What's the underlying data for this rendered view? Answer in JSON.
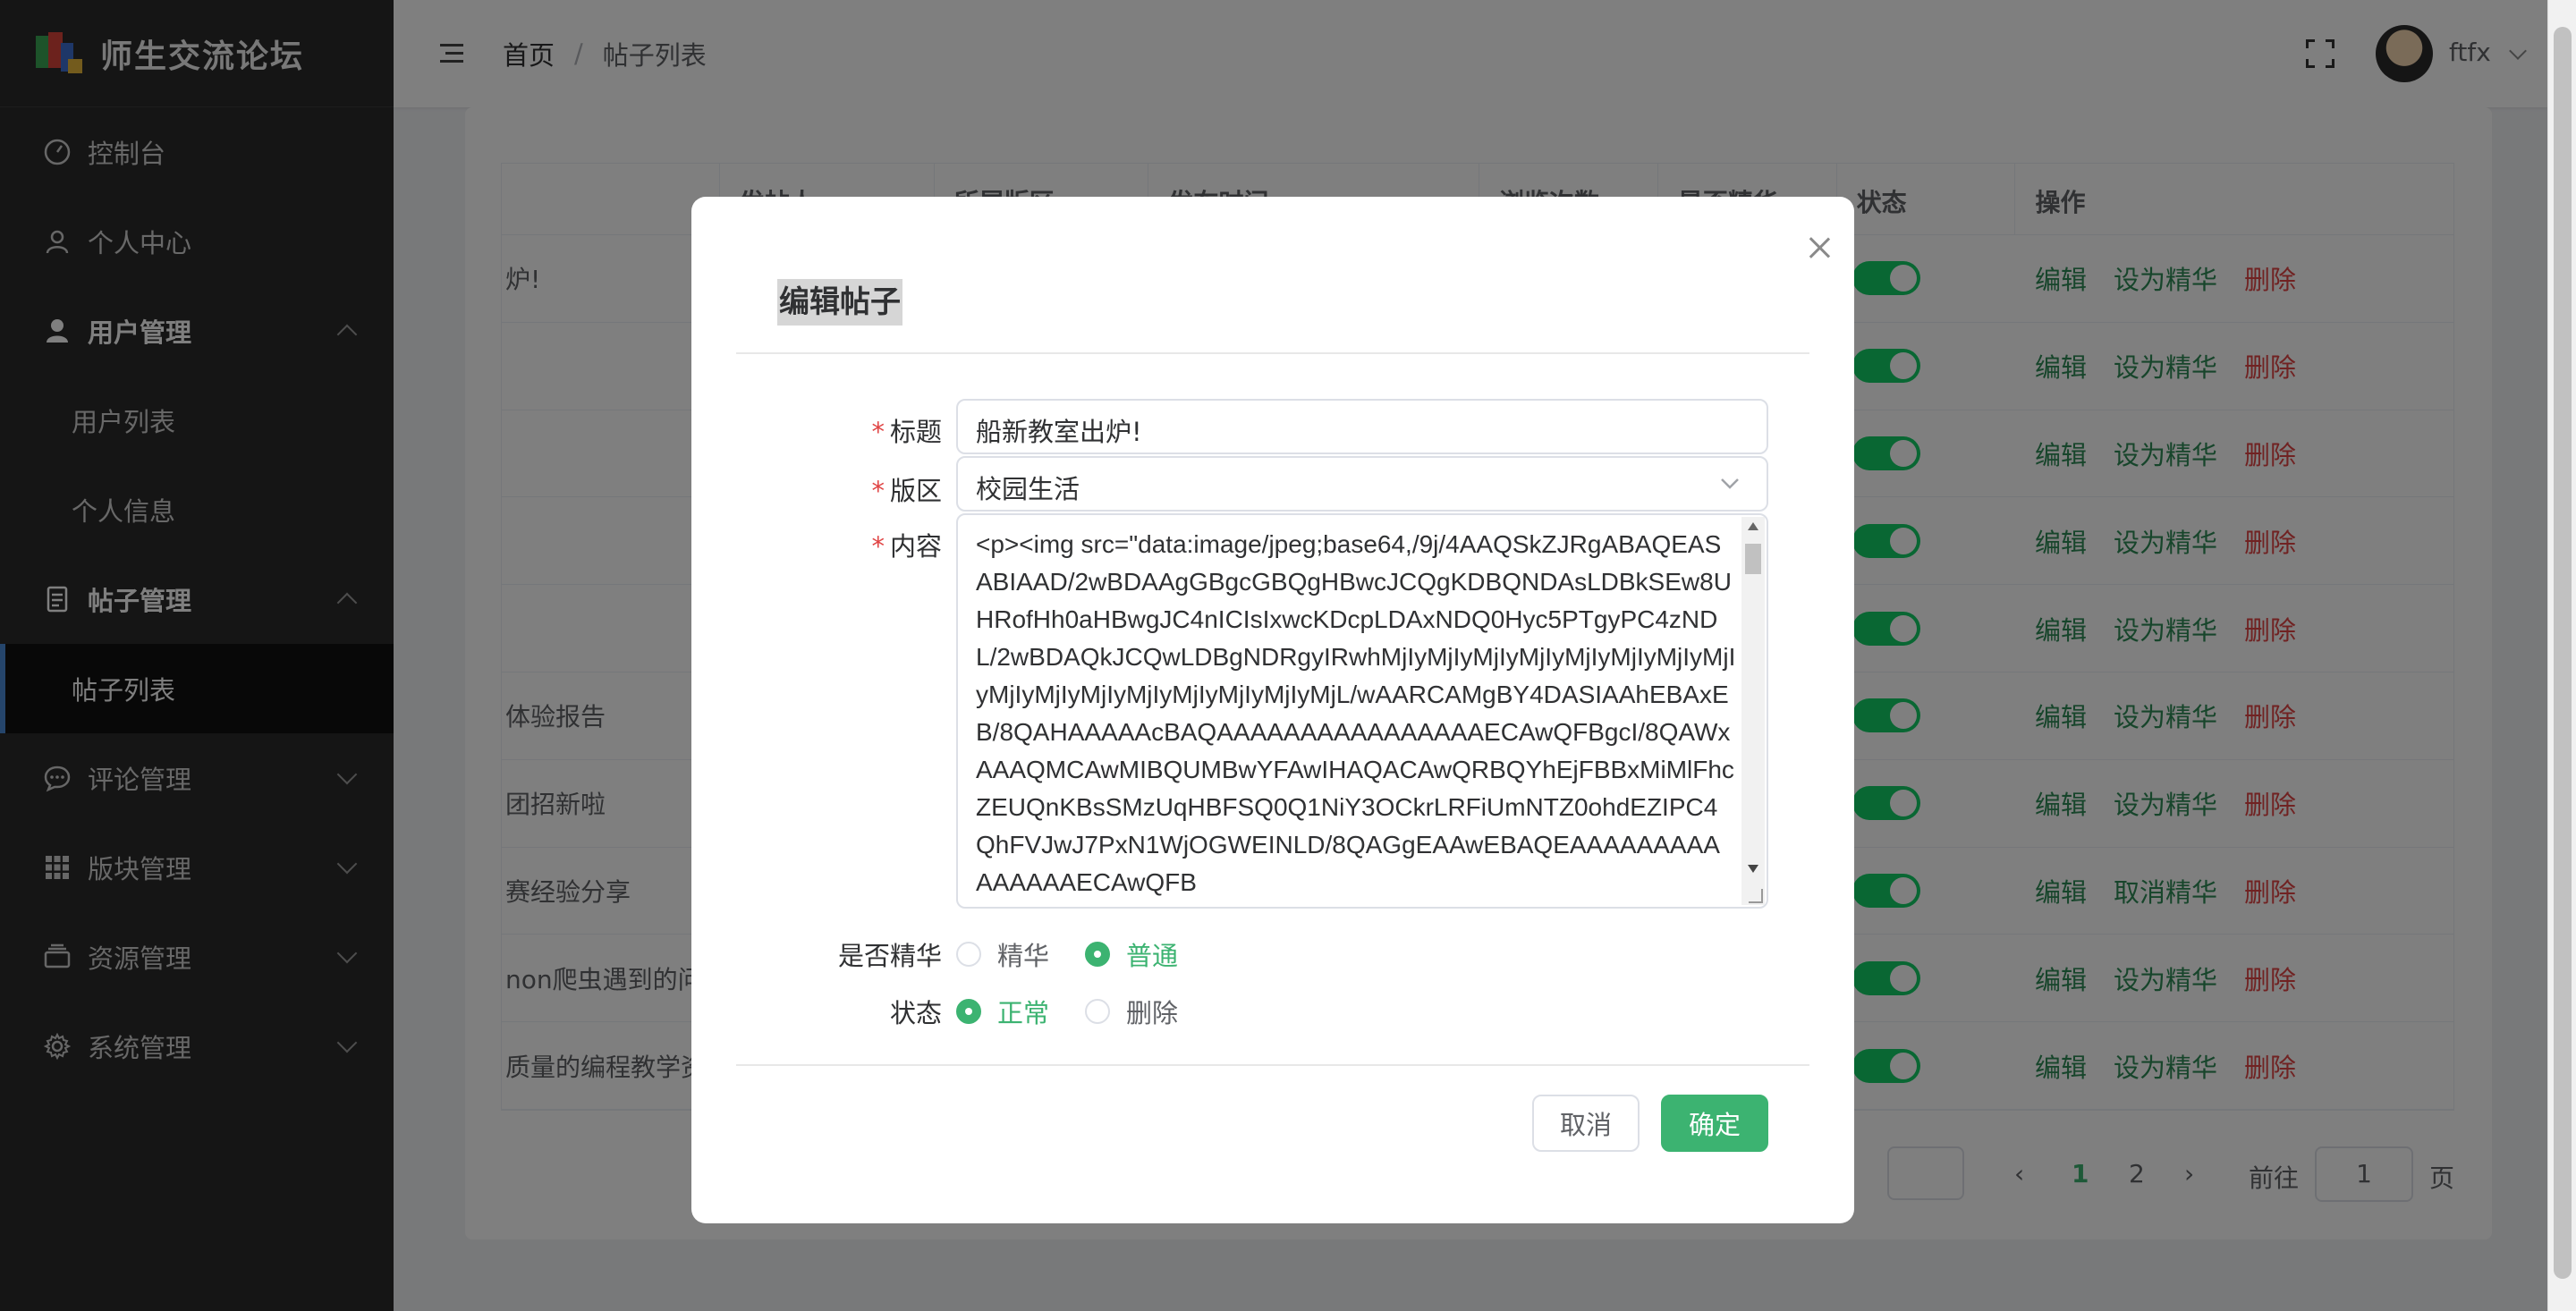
{
  "brand": {
    "title": "师生交流论坛"
  },
  "sidebar": {
    "items": [
      {
        "label": "控制台",
        "icon": "dashboard-icon"
      },
      {
        "label": "个人中心",
        "icon": "user-icon"
      },
      {
        "label": "用户管理",
        "icon": "user-solid-icon",
        "expanded": true,
        "children": [
          {
            "label": "用户列表"
          },
          {
            "label": "个人信息"
          }
        ]
      },
      {
        "label": "帖子管理",
        "icon": "document-icon",
        "expanded": true,
        "children": [
          {
            "label": "帖子列表",
            "active": true
          }
        ]
      },
      {
        "label": "评论管理",
        "icon": "chat-icon"
      },
      {
        "label": "版块管理",
        "icon": "grid-icon"
      },
      {
        "label": "资源管理",
        "icon": "folder-icon"
      },
      {
        "label": "系统管理",
        "icon": "gear-icon"
      }
    ]
  },
  "header": {
    "breadcrumb": {
      "home": "首页",
      "separator": "/",
      "current": "帖子列表"
    },
    "username": "ftfx"
  },
  "table": {
    "headers": [
      "发帖人",
      "所属版区",
      "发布时间",
      "浏览次数",
      "是否精华",
      "状态",
      "操作"
    ],
    "rows": [
      {
        "title": "炉!",
        "feature_op": "设为精华"
      },
      {
        "title": "",
        "feature_op": "设为精华"
      },
      {
        "title": "",
        "feature_op": "设为精华"
      },
      {
        "title": "",
        "feature_op": "设为精华"
      },
      {
        "title": "",
        "feature_op": "设为精华"
      },
      {
        "title": "体验报告",
        "feature_op": "设为精华"
      },
      {
        "title": "团招新啦",
        "feature_op": "设为精华"
      },
      {
        "title": "赛经验分享",
        "feature_op": "取消精华"
      },
      {
        "title": "non爬虫遇到的问题",
        "feature_op": "设为精华"
      },
      {
        "title": "质量的编程教学资",
        "feature_op": "设为精华"
      }
    ],
    "op_edit": "编辑",
    "op_delete": "删除"
  },
  "pagination": {
    "pages": [
      "1",
      "2"
    ],
    "current": "1",
    "goto_label": "前往",
    "goto_value": "1",
    "page_unit": "页"
  },
  "dialog": {
    "title": "编辑帖子",
    "fields": {
      "title_label": "标题",
      "title_value": "船新教室出炉!",
      "section_label": "版区",
      "section_value": "校园生活",
      "content_label": "内容",
      "content_value": "<p><img src=\"data:image/jpeg;base64,/9j/4AAQSkZJRgABAQEASABIAAD/2wBDAAgGBgcGBQgHBwcJCQgKDBQNDAsLDBkSEw8UHRofHh0aHBwgJC4nICIsIxwcKDcpLDAxNDQ0Hyc5PTgyPC4zNDL/2wBDAQkJCQwLDBgNDRgyIRwhMjIyMjIyMjIyMjIyMjIyMjIyMjIyMjIyMjIyMjIyMjIyMjIyMjIyMjIyMjIyMjL/wAARCAMgBY4DASIAAhEBAxEB/8QAHAAAAAcBAQAAAAAAAAAAAAAAAAECAwQFBgcI/8QAWxAAAQMCAwMIBQUMBwYFAwIHAQACAwQRBQYhEjFBBxMiMlFhcZEUQnKBsSMzUqHBFSQ0Q1NiY3OCkrLRFiUmNTZ0ohdEZIPC4QhFVJwJ7PxN1WjOGWEINLD/8QAGgEAAwEBAQEAAAAAAAAAAAAAAAECAwQFB"
    },
    "featured": {
      "label": "是否精华",
      "options": [
        "精华",
        "普通"
      ],
      "selected": "普通"
    },
    "status": {
      "label": "状态",
      "options": [
        "正常",
        "删除"
      ],
      "selected": "正常"
    },
    "buttons": {
      "cancel": "取消",
      "confirm": "确定"
    }
  },
  "colors": {
    "accent": "#3cb371",
    "danger": "#e04545",
    "sidebar_bg": "#2b2b2b",
    "switch_on": "#13ce66"
  }
}
